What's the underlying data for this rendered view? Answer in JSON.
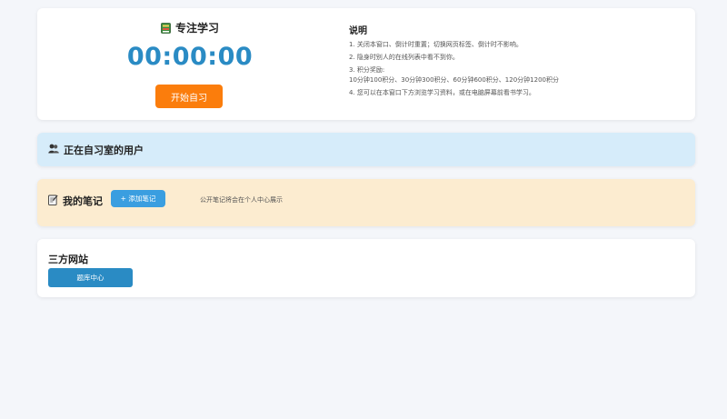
{
  "timer_card": {
    "title": "专注学习",
    "title_icon": "book-icon",
    "time": "00:00:00",
    "start_button": "开始自习",
    "start_button_color": "#fb7d0c",
    "time_color": "#2a8bc4"
  },
  "instructions": {
    "title": "说明",
    "items": [
      "1. 关闭本窗口、倒计时重置；切换网页标签、倒计时不影响。",
      "2. 隐身时别人的在线列表中看不到你。",
      "3. 积分奖励:",
      "10分钟100积分、30分钟300积分、60分钟600积分、120分钟1200积分",
      "4. 您可以在本窗口下方浏览学习资料，或在电脑屏幕前看书学习。"
    ]
  },
  "users_card": {
    "title": "正在自习室的用户",
    "icon": "users-icon",
    "background": "#d6ecfa"
  },
  "notes_card": {
    "title": "我的笔记",
    "icon": "notepad-icon",
    "add_button": "+ 添加笔记",
    "hint": "公开笔记将会在个人中心展示",
    "background": "#fcecd0"
  },
  "third_party": {
    "title": "三方网站",
    "button": "题库中心"
  }
}
